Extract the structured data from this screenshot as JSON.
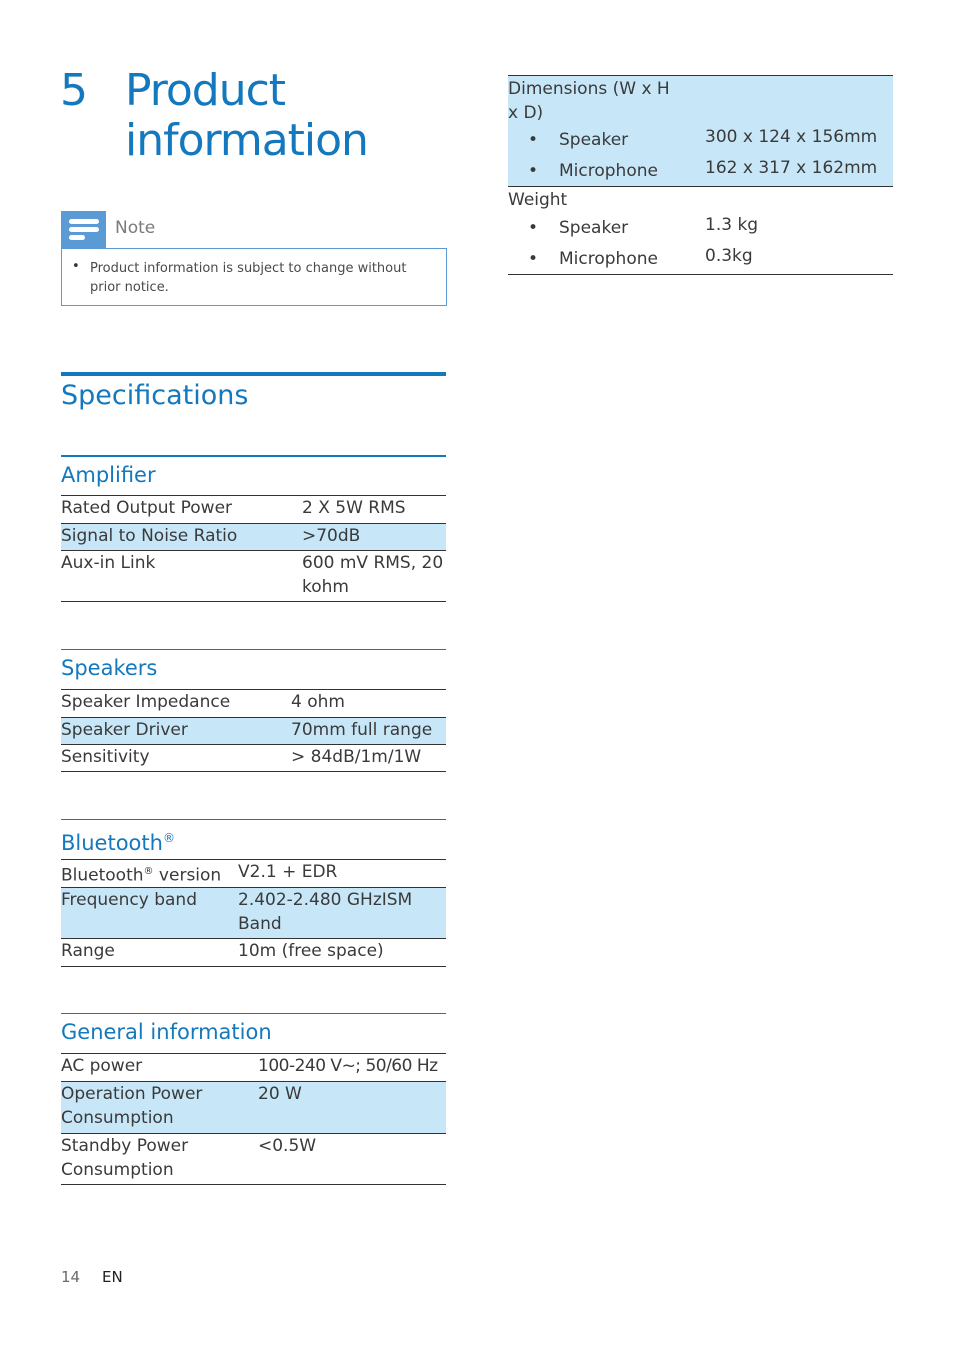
{
  "chapter": {
    "number": "5",
    "title_line1": "Product",
    "title_line2": "information"
  },
  "note": {
    "label": "Note",
    "icon": "note-icon",
    "bullet": "•",
    "text": "Product information is subject to change without prior notice."
  },
  "specifications": {
    "title": "Specifications"
  },
  "sections": {
    "amplifier": {
      "title": "Amplifier",
      "rows": [
        {
          "key": "Rated Output Power",
          "value": "2 X 5W RMS"
        },
        {
          "key": "Signal to Noise Ratio",
          "value": ">70dB"
        },
        {
          "key": "Aux-in Link",
          "value": "600 mV RMS, 20 kohm"
        }
      ]
    },
    "speakers": {
      "title": "Speakers",
      "rows": [
        {
          "key": "Speaker Impedance",
          "value": "4 ohm"
        },
        {
          "key": "Speaker Driver",
          "value": "70mm full range"
        },
        {
          "key": "Sensitivity",
          "value": "> 84dB/1m/1W"
        }
      ]
    },
    "bluetooth": {
      "title": "Bluetooth",
      "title_sup": "®",
      "rows": [
        {
          "key": "Bluetooth",
          "key_sup": "®",
          "key_suffix": " version",
          "value": "V2.1 + EDR"
        },
        {
          "key": "Frequency band",
          "value": "2.402-2.480 GHzISM Band"
        },
        {
          "key": "Range",
          "value": "10m (free space)"
        }
      ]
    },
    "general": {
      "title": "General information",
      "rows": [
        {
          "key": "AC power",
          "value": "100-240 V~; 50/60 Hz"
        },
        {
          "key": "Operation Power Consumption",
          "value": "20 W"
        },
        {
          "key": "Standby Power Consumption",
          "value": "<0.5W"
        }
      ]
    }
  },
  "general_cont": {
    "dimensions": {
      "label": "Dimensions (W x H x D)",
      "items": [
        {
          "bullet": "•",
          "key": "Speaker",
          "value": "300 x 124 x 156mm"
        },
        {
          "bullet": "•",
          "key": "Microphone",
          "value": "162 x 317 x 162mm"
        }
      ]
    },
    "weight": {
      "label": "Weight",
      "items": [
        {
          "bullet": "•",
          "key": "Speaker",
          "value": "1.3 kg"
        },
        {
          "bullet": "•",
          "key": "Microphone",
          "value": "0.3kg"
        }
      ]
    }
  },
  "footer": {
    "page": "14",
    "lang": "EN"
  },
  "colors": {
    "accent": "#1478be",
    "highlight_row": "#c7e7f8",
    "note_icon": "#5b9bd5"
  }
}
